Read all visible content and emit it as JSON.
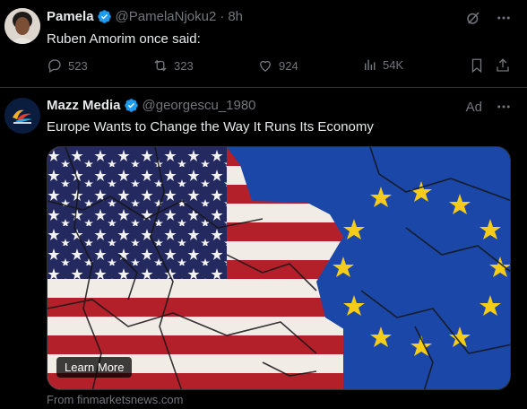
{
  "tweet1": {
    "author_name": "Pamela",
    "handle": "@PamelaNjoku2",
    "separator": "·",
    "time": "8h",
    "text": "Ruben Amorim once said:",
    "replies": "523",
    "reposts": "323",
    "likes": "924",
    "views": "54K",
    "top_icons": [
      "grok-icon",
      "more-icon"
    ],
    "action_icons": [
      "reply-icon",
      "repost-icon",
      "like-icon",
      "views-icon",
      "bookmark-icon",
      "share-icon"
    ]
  },
  "tweet2": {
    "author_name": "Mazz Media",
    "handle": "@georgescu_1980",
    "ad_label": "Ad",
    "text": "Europe Wants to Change the Way It Runs Its Economy",
    "cta": "Learn More",
    "source": "From finmarketsnews.com",
    "image": "cracked-usa-eu-flags-image"
  },
  "colors": {
    "background": "#000000",
    "text": "#e7e9ea",
    "muted": "#71767b",
    "verified": "#1d9bf0",
    "divider": "#2f3336"
  }
}
